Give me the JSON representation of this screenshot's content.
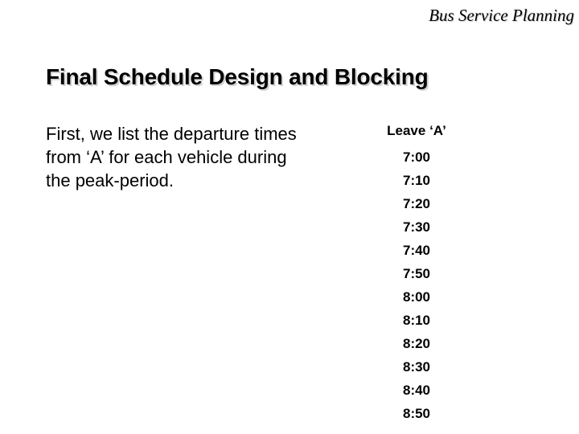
{
  "header": {
    "running_title": "Bus Service Planning"
  },
  "slide": {
    "title": "Final Schedule Design and Blocking"
  },
  "left": {
    "paragraph": "First, we list the departure times from ‘A’ for each vehicle during the peak-period."
  },
  "schedule": {
    "column_header": "Leave ‘A’",
    "times": [
      "7:00",
      "7:10",
      "7:20",
      "7:30",
      "7:40",
      "7:50",
      "8:00",
      "8:10",
      "8:20",
      "8:30",
      "8:40",
      "8:50"
    ]
  },
  "colors": {
    "text": "#000000",
    "background": "#ffffff",
    "title_shadow": "#d2d2d2",
    "header_shadow": "#c8c8c8"
  }
}
